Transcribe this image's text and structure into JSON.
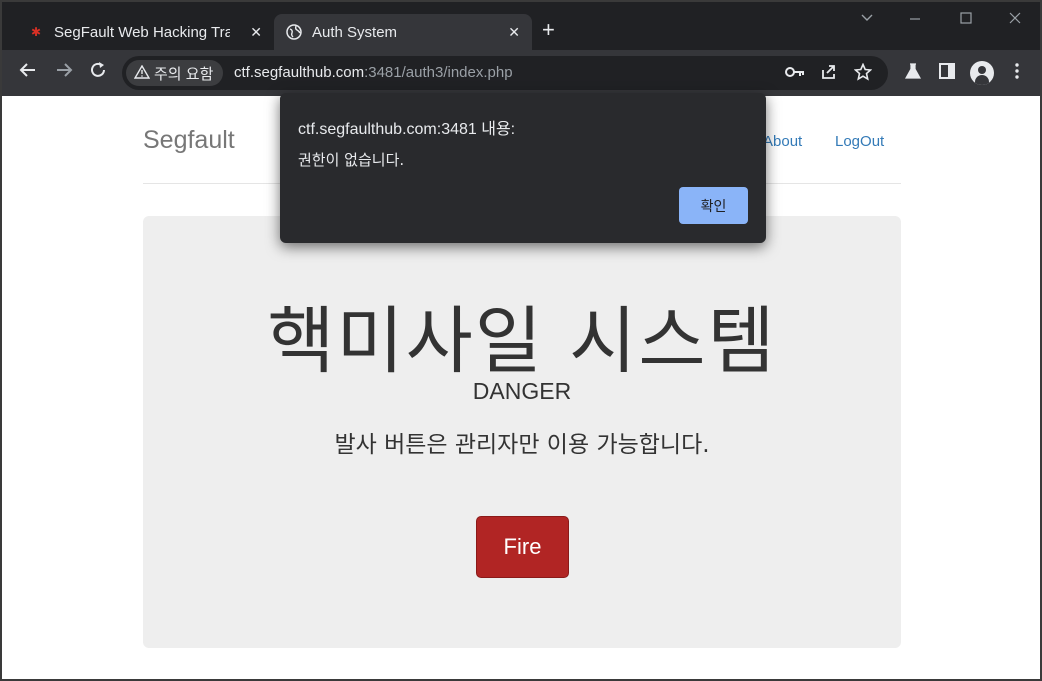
{
  "browser": {
    "tabs": [
      {
        "title": "SegFault Web Hacking Trai",
        "favicon": "bug-icon",
        "active": false
      },
      {
        "title": "Auth System",
        "favicon": "globe-icon",
        "active": true
      }
    ],
    "new_tab": "+",
    "close_glyph": "✕",
    "security_label": "주의 요함",
    "url_host": "ctf.segfaulthub.com",
    "url_path": ":3481/auth3/index.php",
    "accent": "#8ab4f8"
  },
  "page": {
    "brand": "Segfault",
    "nav": {
      "about": "About",
      "logout": "LogOut"
    },
    "hero_title": "핵미사일 시스템",
    "subtitle": "DANGER",
    "description": "발사 버튼은 관리자만 이용 가능합니다.",
    "fire_label": "Fire",
    "fire_color": "#b12524"
  },
  "dialog": {
    "heading": "ctf.segfaulthub.com:3481 내용:",
    "message": "권한이 없습니다.",
    "ok_label": "확인"
  }
}
